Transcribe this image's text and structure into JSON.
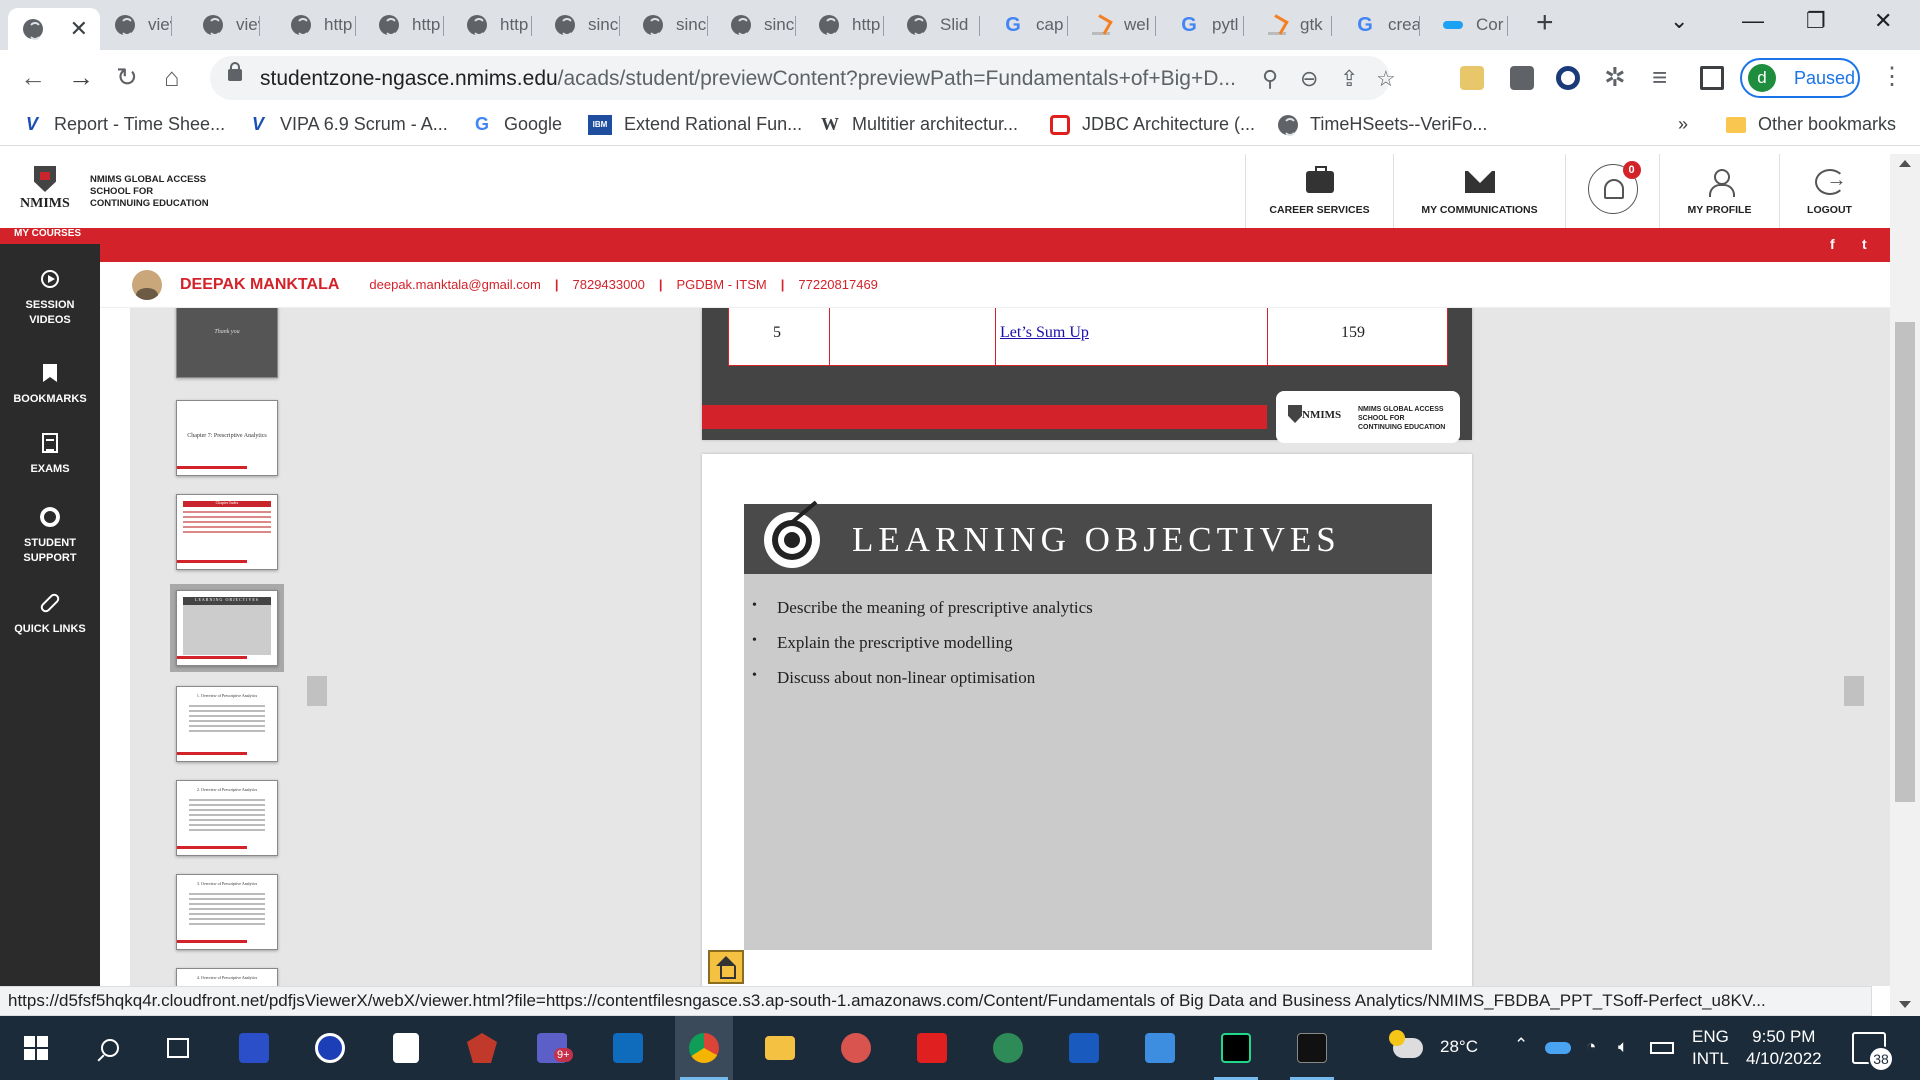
{
  "browser": {
    "tabs": [
      {
        "label": "",
        "icon": "globe-icon",
        "active": true
      },
      {
        "label": "viev",
        "icon": "globe-icon"
      },
      {
        "label": "viev",
        "icon": "globe-icon"
      },
      {
        "label": "http",
        "icon": "globe-icon"
      },
      {
        "label": "http",
        "icon": "globe-icon"
      },
      {
        "label": "http",
        "icon": "globe-icon"
      },
      {
        "label": "sinc",
        "icon": "globe-icon"
      },
      {
        "label": "sinc",
        "icon": "globe-icon"
      },
      {
        "label": "sinc",
        "icon": "globe-icon"
      },
      {
        "label": "http",
        "icon": "globe-icon"
      },
      {
        "label": "Slid",
        "icon": "globe-icon"
      },
      {
        "label": "cap",
        "icon": "google-icon"
      },
      {
        "label": "wel",
        "icon": "stackoverflow-icon"
      },
      {
        "label": "pytl",
        "icon": "google-icon"
      },
      {
        "label": "gtk",
        "icon": "stackoverflow-icon"
      },
      {
        "label": "crea",
        "icon": "google-icon"
      },
      {
        "label": "Cor",
        "icon": "bird-icon"
      }
    ],
    "new_tab_symbol": "+",
    "url_host": "studentzone-ngasce.nmims.edu",
    "url_path": "/acads/student/previewContent?previewPath=Fundamentals+of+Big+D...",
    "profile_initial": "d",
    "profile_status": "Paused",
    "bookmarks": [
      {
        "label": "Report - Time Shee...",
        "icon": "v-icon"
      },
      {
        "label": "VIPA 6.9 Scrum - A...",
        "icon": "v-icon"
      },
      {
        "label": "Google",
        "icon": "google-icon"
      },
      {
        "label": "Extend Rational Fun...",
        "icon": "ibm-icon"
      },
      {
        "label": "Multitier architectur...",
        "icon": "wikipedia-icon"
      },
      {
        "label": "JDBC Architecture (...",
        "icon": "oracle-icon"
      },
      {
        "label": "TimeHSeets--VeriFo...",
        "icon": "globe-icon"
      }
    ],
    "bookmarks_overflow": "»",
    "other_bookmarks": "Other bookmarks",
    "status_url": "https://d5fsf5hqkq4r.cloudfront.net/pdfjsViewerX/webX/viewer.html?file=https://contentfilesngasce.s3.ap-south-1.amazonaws.com/Content/Fundamentals of Big Data and Business Analytics/NMIMS_FBDBA_PPT_TSoff-Perfect_u8KV..."
  },
  "site": {
    "logo_word": "NMIMS",
    "logo_lines": [
      "NMIMS GLOBAL ACCESS",
      "SCHOOL FOR",
      "CONTINUING EDUCATION"
    ],
    "header_items": [
      {
        "label": "CAREER SERVICES",
        "icon": "briefcase-icon"
      },
      {
        "label": "MY COMMUNICATIONS",
        "icon": "envelope-icon"
      },
      {
        "label": "",
        "icon": "bell-icon"
      },
      {
        "label": "MY PROFILE",
        "icon": "user-icon"
      },
      {
        "label": "LOGOUT",
        "icon": "logout-icon"
      }
    ],
    "notification_count": "0",
    "my_courses": "MY COURSES",
    "social": [
      "f",
      "t"
    ],
    "user": {
      "name": "DEEPAK MANKTALA",
      "email": "deepak.manktala@gmail.com",
      "phone": "7829433000",
      "program": "PGDBM - ITSM",
      "id": "77220817469"
    },
    "nav": [
      {
        "label1": "SESSION",
        "label2": "VIDEOS",
        "icon": "play-icon"
      },
      {
        "label1": "BOOKMARKS",
        "label2": "",
        "icon": "bookmark-icon"
      },
      {
        "label1": "EXAMS",
        "label2": "",
        "icon": "exam-icon"
      },
      {
        "label1": "STUDENT",
        "label2": "SUPPORT",
        "icon": "lifebuoy-icon"
      },
      {
        "label1": "QUICK LINKS",
        "label2": "",
        "icon": "link-icon"
      }
    ]
  },
  "viewer": {
    "thumbnails": [
      {
        "title": "Thank you",
        "kind": "dark"
      },
      {
        "title": "Chapter 7: Prescriptive Analytics",
        "kind": "title"
      },
      {
        "title": "Chapter Index",
        "kind": "table"
      },
      {
        "title": "LEARNING OBJECTIVES",
        "kind": "objectives",
        "selected": true
      },
      {
        "title": "1. Overview of Prescriptive Analytics",
        "kind": "text"
      },
      {
        "title": "2. Overview of Prescriptive Analytics",
        "kind": "text"
      },
      {
        "title": "3. Overview of Prescriptive Analytics",
        "kind": "text"
      },
      {
        "title": "4. Overview of Prescriptive Analytics",
        "kind": "text"
      }
    ],
    "toc_row": {
      "sno": "5",
      "topic": "Let’s Sum Up",
      "page": "159"
    },
    "slide_logo_word": "NMIMS",
    "slide_logo_lines": [
      "NMIMS GLOBAL ACCESS",
      "SCHOOL FOR",
      "CONTINUING EDUCATION"
    ],
    "slide_title": "LEARNING OBJECTIVES",
    "bullet_symbol": "•",
    "objectives": [
      "Describe the meaning of prescriptive analytics",
      "Explain the prescriptive modelling",
      "Discuss about non-linear optimisation"
    ]
  },
  "taskbar": {
    "temperature": "28°C",
    "lang_top": "ENG",
    "lang_bottom": "INTL",
    "time": "9:50 PM",
    "date": "4/10/2022",
    "notification_count": "38",
    "teams_badge": "9+"
  }
}
